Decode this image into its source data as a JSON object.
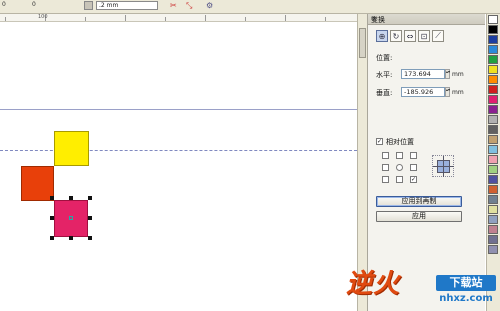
{
  "toolbar": {
    "ruler_zero_a": "0",
    "ruler_zero_b": "0",
    "nudge_value": ".2 mm",
    "ruler_label_100": "100"
  },
  "docker": {
    "title": "变换",
    "section_position": "位置:",
    "h_label": "水平:",
    "h_value": "173.694",
    "h_unit": "mm",
    "v_label": "垂直:",
    "v_value": "-185.926",
    "v_unit": "mm",
    "relative_label": "相对位置",
    "apply_to_copy": "应用到再制",
    "apply": "应用"
  },
  "round_button": "58",
  "watermark": {
    "brand": "逆火",
    "chip": "下载站",
    "domain": "nhxz.com"
  },
  "colors": {
    "yellow_square": "#ffee00",
    "red_square": "#e8400a",
    "pink_square": "#e42367",
    "guide": "#9aa0c8"
  },
  "palette": [
    "#ffffff",
    "#000000",
    "#1e3fa0",
    "#2c8ad8",
    "#20a040",
    "#f0e020",
    "#ff8c00",
    "#d02020",
    "#e02070",
    "#8a2090",
    "#b0b0b0",
    "#606060",
    "#c0a070",
    "#80c0e0",
    "#f0a0b0",
    "#a0d080",
    "#5050a0",
    "#d06030",
    "#708090",
    "#e0e0a0",
    "#90a0c0",
    "#c08090",
    "#707090",
    "#9090b0"
  ]
}
